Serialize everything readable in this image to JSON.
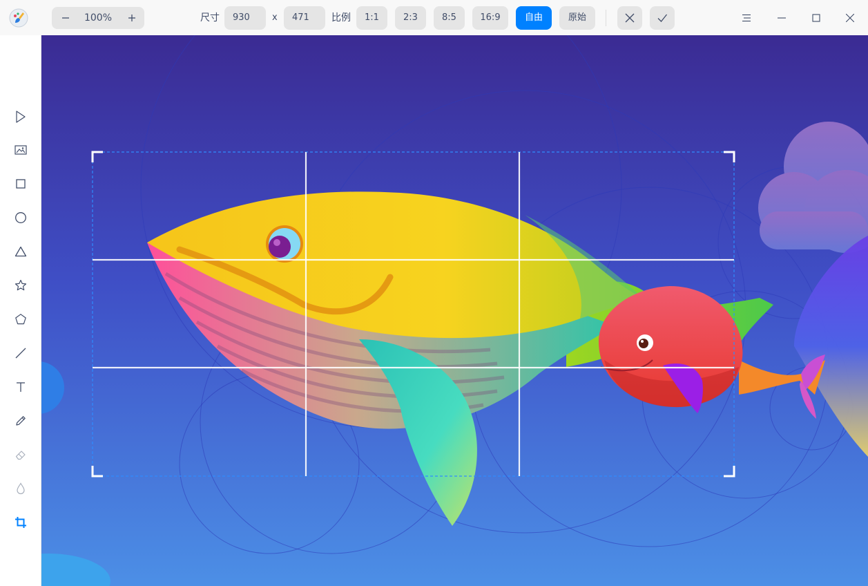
{
  "toolbar": {
    "zoom_value": "100%",
    "size_label": "尺寸",
    "width_value": "930",
    "times_label": "x",
    "height_value": "471",
    "ratio_label": "比例",
    "ratios": [
      "1:1",
      "2:3",
      "8:5",
      "16:9"
    ],
    "free_label": "自由",
    "original_label": "原始",
    "selected_mode": "自由"
  },
  "colors": {
    "accent": "#0081ff",
    "toolbar_bg": "#f8f8f8",
    "button_bg": "#e5e5e5",
    "text": "#414d68"
  },
  "sidebar": {
    "tools": [
      {
        "name": "select-icon"
      },
      {
        "name": "image-icon"
      },
      {
        "name": "rectangle-icon"
      },
      {
        "name": "ellipse-icon"
      },
      {
        "name": "triangle-icon"
      },
      {
        "name": "star-icon"
      },
      {
        "name": "polygon-icon"
      },
      {
        "name": "line-icon"
      },
      {
        "name": "text-icon"
      },
      {
        "name": "pencil-icon"
      },
      {
        "name": "eraser-icon"
      },
      {
        "name": "blur-icon"
      },
      {
        "name": "crop-icon"
      }
    ],
    "active_tool": "crop-icon"
  }
}
